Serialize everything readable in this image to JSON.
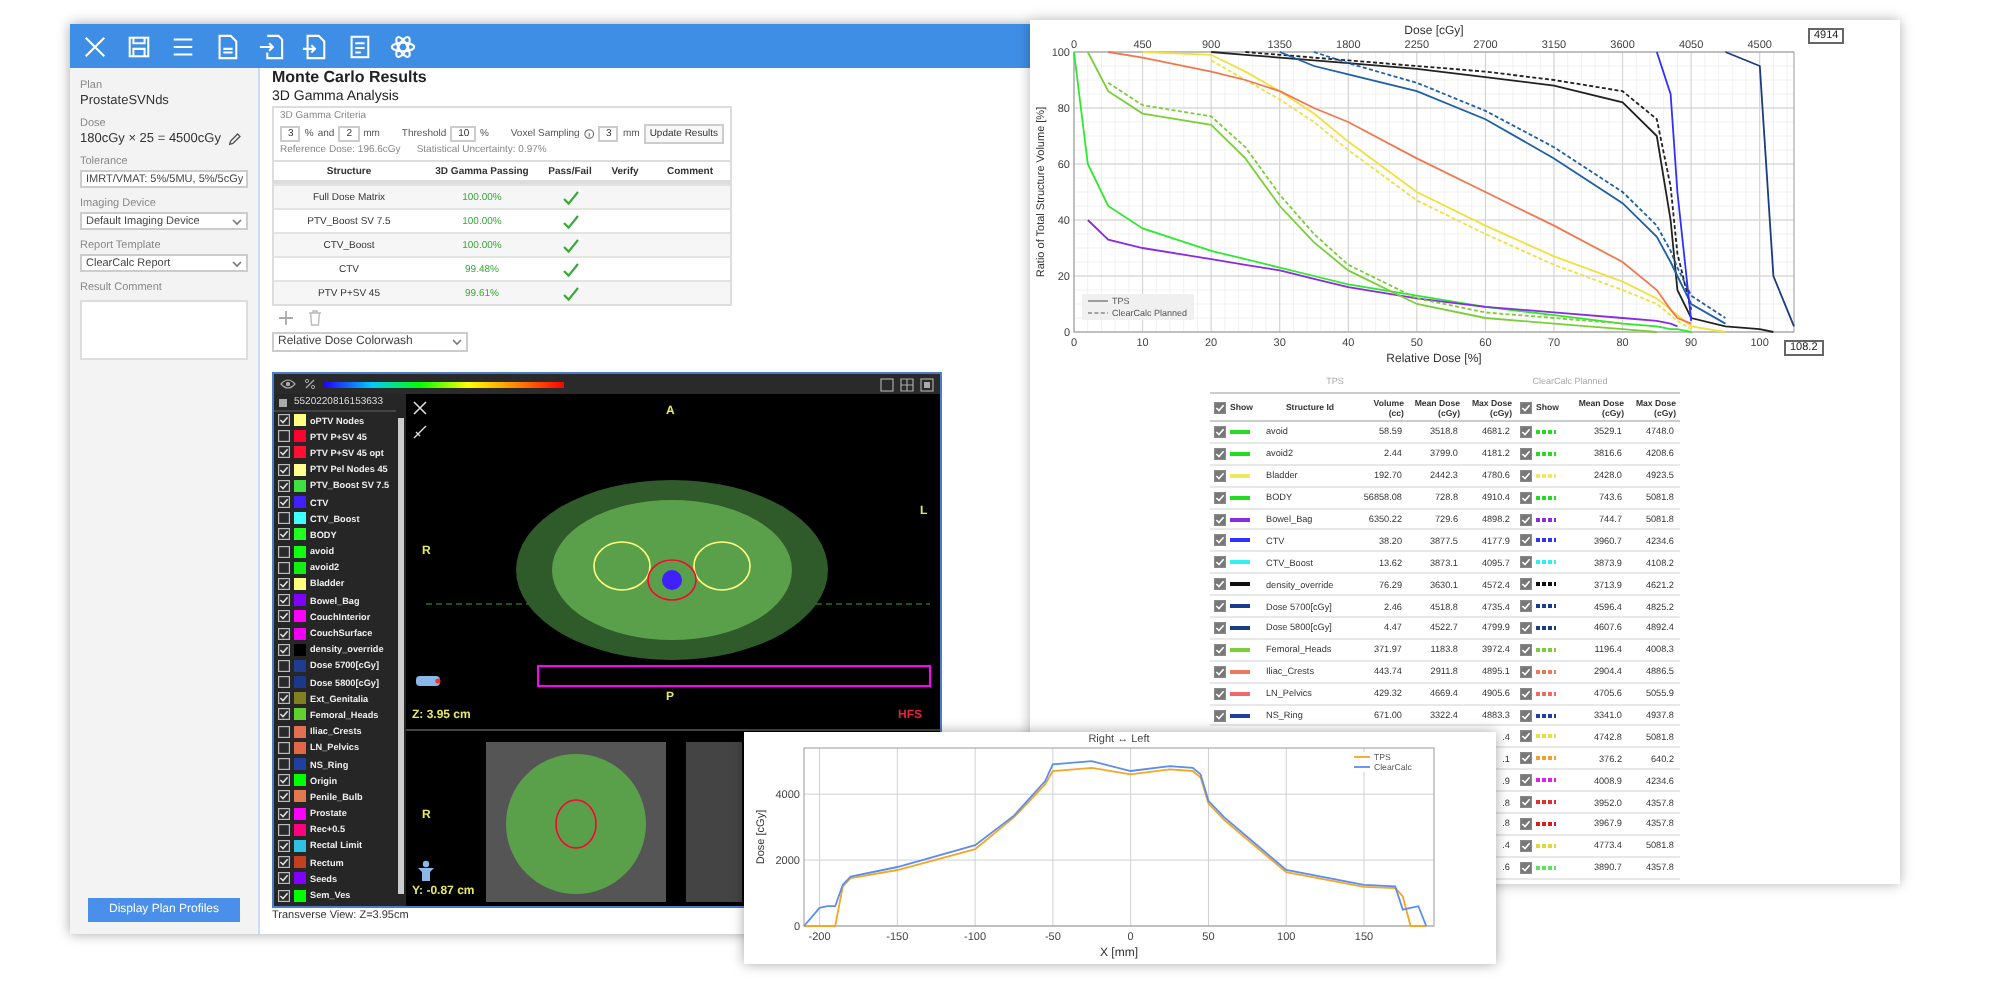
{
  "sidebar": {
    "fields": [
      {
        "label": "Plan",
        "value": "ProstateSVNds",
        "kind": "text"
      },
      {
        "label": "Dose",
        "value": "180cGy × 25 = 4500cGy",
        "kind": "editable"
      },
      {
        "label": "Tolerance",
        "value": "IMRT/VMAT: 5%/5MU, 5%/5cGy",
        "kind": "dropdown"
      },
      {
        "label": "Imaging Device",
        "value": "Default Imaging Device",
        "kind": "dropdown"
      },
      {
        "label": "Report Template",
        "value": "ClearCalc Report",
        "kind": "dropdown"
      },
      {
        "label": "Result Comment",
        "kind": "textarea"
      }
    ],
    "button": "Display Plan Profiles"
  },
  "results": {
    "title": "Monte Carlo Results",
    "subtitle": "3D Gamma Analysis",
    "criteria": {
      "title": "3D Gamma Criteria",
      "dose_percent": "3",
      "dose_unit": "%",
      "and": "and",
      "distance": "2",
      "distance_unit": "mm",
      "threshold_label": "Threshold",
      "threshold": "10",
      "threshold_unit": "%",
      "voxel_label": "Voxel Sampling",
      "voxel": "3",
      "voxel_unit": "mm",
      "button": "Update Results",
      "reference_dose": "Reference Dose: 196.6cGy",
      "uncertainty": "Statistical Uncertainty: 0.97%"
    },
    "table": {
      "columns": [
        "Structure",
        "3D Gamma Passing",
        "Pass/Fail",
        "Verify",
        "Comment"
      ],
      "rows": [
        {
          "structure": "Full Dose Matrix",
          "passing": "100.00%",
          "pass": true
        },
        {
          "structure": "PTV_Boost SV 7.5",
          "passing": "100.00%",
          "pass": true
        },
        {
          "structure": "CTV_Boost",
          "passing": "100.00%",
          "pass": true
        },
        {
          "structure": "CTV",
          "passing": "99.48%",
          "pass": true
        },
        {
          "structure": "PTV P+SV 45",
          "passing": "99.61%",
          "pass": true
        }
      ]
    },
    "display_mode": "Relative Dose Colorwash"
  },
  "viewer": {
    "plan_id": "5520220816153633",
    "structures": [
      {
        "name": "oPTV Nodes",
        "checked": true,
        "color": "#ffff80"
      },
      {
        "name": "PTV P+SV 45",
        "checked": false,
        "color": "#ff0030"
      },
      {
        "name": "PTV P+SV 45 opt",
        "checked": true,
        "color": "#ff1030"
      },
      {
        "name": "PTV Pel Nodes 45",
        "checked": true,
        "color": "#ffff90"
      },
      {
        "name": "PTV_Boost SV 7.5",
        "checked": true,
        "color": "#40e040"
      },
      {
        "name": "CTV",
        "checked": true,
        "color": "#4020ff"
      },
      {
        "name": "CTV_Boost",
        "checked": false,
        "color": "#40ffff"
      },
      {
        "name": "BODY",
        "checked": true,
        "color": "#20ff20"
      },
      {
        "name": "avoid",
        "checked": false,
        "color": "#10ff10"
      },
      {
        "name": "avoid2",
        "checked": false,
        "color": "#10f010"
      },
      {
        "name": "Bladder",
        "checked": true,
        "color": "#ffff80"
      },
      {
        "name": "Bowel_Bag",
        "checked": true,
        "color": "#8000ff"
      },
      {
        "name": "CouchInterior",
        "checked": true,
        "color": "#ff00ff"
      },
      {
        "name": "CouchSurface",
        "checked": true,
        "color": "#f000f0"
      },
      {
        "name": "density_override",
        "checked": true,
        "color": "#000000"
      },
      {
        "name": "Dose 5700[cGy]",
        "checked": false,
        "color": "#203c90"
      },
      {
        "name": "Dose 5800[cGy]",
        "checked": false,
        "color": "#1c3888"
      },
      {
        "name": "Ext_Genitalia",
        "checked": true,
        "color": "#808020"
      },
      {
        "name": "Femoral_Heads",
        "checked": true,
        "color": "#60d030"
      },
      {
        "name": "Iliac_Crests",
        "checked": false,
        "color": "#e07050"
      },
      {
        "name": "LN_Pelvics",
        "checked": false,
        "color": "#e06848"
      },
      {
        "name": "NS_Ring",
        "checked": false,
        "color": "#2040a0"
      },
      {
        "name": "Origin",
        "checked": true,
        "color": "#00ff00"
      },
      {
        "name": "Penile_Bulb",
        "checked": true,
        "color": "#e07850"
      },
      {
        "name": "Prostate",
        "checked": true,
        "color": "#ff00ff"
      },
      {
        "name": "Rec+0.5",
        "checked": false,
        "color": "#ff0080"
      },
      {
        "name": "Rectal Limit",
        "checked": true,
        "color": "#30c0e0"
      },
      {
        "name": "Rectum",
        "checked": true,
        "color": "#c04020"
      },
      {
        "name": "Seeds",
        "checked": true,
        "color": "#8000ff"
      },
      {
        "name": "Sem_Ves",
        "checked": true,
        "color": "#00ff00"
      }
    ],
    "orientation": {
      "anterior": "A",
      "right": "R",
      "left": "L",
      "posterior": "P",
      "lower_right": "R"
    },
    "patient_position": "HFS",
    "z_position": "Z: 3.95 cm",
    "y_position": "Y: -0.87 cm",
    "caption": "Transverse View: Z=3.95cm"
  },
  "dvh": {
    "dose_axis": {
      "title": "Dose [cGy]",
      "ticks": [
        "0",
        "450",
        "900",
        "1350",
        "1800",
        "2250",
        "2700",
        "3150",
        "3600",
        "4050",
        "4500"
      ]
    },
    "legend": [
      {
        "label": "TPS",
        "dashed": false
      },
      {
        "label": "ClearCalc Planned",
        "dashed": true
      }
    ],
    "chart_data": {
      "type": "line",
      "xlabel": "Relative Dose [%]",
      "ylabel": "Ratio of Total Structure Volume [%]",
      "grid": true,
      "x": [
        0,
        2,
        5,
        10,
        20,
        25,
        30,
        35,
        40,
        50,
        60,
        70,
        80,
        85,
        87,
        88,
        90,
        95,
        100,
        102,
        105
      ],
      "series": [
        {
          "color": "#2ee82e",
          "line_style": "solid",
          "values": [
            100,
            60,
            45,
            37,
            29,
            26,
            23,
            20,
            17,
            13,
            9,
            6,
            3,
            2,
            1,
            1,
            0,
            null,
            null,
            null,
            null
          ]
        },
        {
          "color": "#8a2be2",
          "line_style": "solid",
          "values": [
            null,
            40,
            33,
            30,
            26,
            24,
            22,
            19,
            16,
            12,
            9,
            7,
            5,
            4,
            3,
            2,
            null,
            null,
            null,
            null,
            null
          ]
        },
        {
          "color": "#f0e040",
          "line_style": "solid",
          "values": [
            null,
            null,
            null,
            100,
            99,
            93,
            86,
            78,
            68,
            50,
            38,
            27,
            18,
            12,
            8,
            6,
            2,
            0,
            null,
            null,
            null
          ]
        },
        {
          "color": "#f0e040",
          "line_style": "dashed",
          "values": [
            null,
            null,
            null,
            null,
            97,
            90,
            83,
            75,
            65,
            47,
            35,
            24,
            15,
            10,
            6,
            4,
            1,
            null,
            null,
            null,
            null
          ]
        },
        {
          "color": "#7ccd3a",
          "line_style": "solid",
          "values": [
            null,
            100,
            86,
            78,
            74,
            62,
            45,
            32,
            22,
            10,
            5,
            3,
            1,
            0,
            null,
            null,
            null,
            null,
            null,
            null,
            null
          ]
        },
        {
          "color": "#7ccd3a",
          "line_style": "dashed",
          "values": [
            null,
            null,
            89,
            81,
            77,
            66,
            49,
            35,
            24,
            12,
            7,
            5,
            3,
            null,
            null,
            null,
            null,
            null,
            null,
            null,
            null
          ]
        },
        {
          "color": "#222222",
          "line_style": "solid",
          "values": [
            null,
            null,
            null,
            null,
            100,
            99,
            98,
            97,
            96,
            94,
            91,
            88,
            82,
            70,
            40,
            15,
            5,
            2,
            1,
            0,
            null
          ]
        },
        {
          "color": "#222222",
          "line_style": "dashed",
          "values": [
            null,
            null,
            null,
            null,
            null,
            100,
            99,
            98,
            97,
            95,
            93,
            90,
            86,
            76,
            52,
            28,
            8,
            null,
            null,
            null,
            null
          ]
        },
        {
          "color": "#1f5fa8",
          "line_style": "solid",
          "values": [
            null,
            null,
            null,
            null,
            null,
            null,
            100,
            95,
            92,
            86,
            76,
            62,
            46,
            34,
            25,
            20,
            10,
            3,
            null,
            null,
            null
          ]
        },
        {
          "color": "#1f5fa8",
          "line_style": "dashed",
          "values": [
            null,
            null,
            null,
            null,
            null,
            null,
            null,
            100,
            96,
            89,
            79,
            66,
            50,
            38,
            29,
            23,
            13,
            5,
            null,
            null,
            null
          ]
        },
        {
          "color": "#f07850",
          "line_style": "solid",
          "values": [
            null,
            null,
            100,
            98,
            93,
            90,
            86,
            80,
            75,
            62,
            50,
            38,
            25,
            15,
            8,
            5,
            3,
            null,
            null,
            null,
            null
          ]
        },
        {
          "color": "#3030ff",
          "line_style": "solid",
          "values": [
            null,
            null,
            null,
            null,
            null,
            null,
            null,
            null,
            null,
            null,
            null,
            null,
            null,
            100,
            85,
            50,
            4,
            null,
            null,
            null,
            null
          ]
        },
        {
          "color": "#1a3c80",
          "line_style": "solid",
          "values": [
            null,
            null,
            null,
            null,
            null,
            null,
            null,
            null,
            null,
            null,
            null,
            null,
            null,
            null,
            null,
            null,
            null,
            100,
            95,
            20,
            2
          ]
        }
      ],
      "xlim": [
        0,
        105
      ],
      "ylim": [
        0,
        100
      ],
      "xticks": [
        0,
        10,
        20,
        30,
        40,
        50,
        60,
        70,
        80,
        90,
        100
      ],
      "yticks": [
        0,
        20,
        40,
        60,
        80,
        100
      ]
    },
    "top_readout": "4914",
    "bottom_readout": "108.2",
    "table": {
      "group_headers": [
        "TPS",
        "ClearCalc Planned"
      ],
      "show_all_checked": [
        true,
        true
      ],
      "columns": [
        "Show",
        "Structure Id",
        "Volume (cc)",
        "Mean Dose (cGy)",
        "Max Dose (cGy)",
        "Show",
        "Mean Dose (cGy)",
        "Max Dose (cGy)"
      ],
      "rows": [
        {
          "kind": "full",
          "color": "#22dd22",
          "tps_show": true,
          "name": "avoid",
          "volume": "58.59",
          "tps_mean": "3518.8",
          "tps_max": "4681.2",
          "cc_show": true,
          "cc_mean": "3529.1",
          "cc_max": "4748.0"
        },
        {
          "kind": "full",
          "color": "#22dd22",
          "tps_show": true,
          "name": "avoid2",
          "volume": "2.44",
          "tps_mean": "3799.0",
          "tps_max": "4181.2",
          "cc_show": true,
          "cc_mean": "3816.6",
          "cc_max": "4208.6"
        },
        {
          "kind": "full",
          "color": "#f0e860",
          "tps_show": true,
          "name": "Bladder",
          "volume": "192.70",
          "tps_mean": "2442.3",
          "tps_max": "4780.6",
          "cc_show": true,
          "cc_mean": "2428.0",
          "cc_max": "4923.5"
        },
        {
          "kind": "full",
          "color": "#22dd22",
          "tps_show": true,
          "name": "BODY",
          "volume": "56858.08",
          "tps_mean": "728.8",
          "tps_max": "4910.4",
          "cc_show": true,
          "cc_mean": "743.6",
          "cc_max": "5081.8"
        },
        {
          "kind": "full",
          "color": "#8a2be2",
          "tps_show": true,
          "name": "Bowel_Bag",
          "volume": "6350.22",
          "tps_mean": "729.6",
          "tps_max": "4898.2",
          "cc_show": true,
          "cc_mean": "744.7",
          "cc_max": "5081.8"
        },
        {
          "kind": "full",
          "color": "#3030ff",
          "tps_show": true,
          "name": "CTV",
          "volume": "38.20",
          "tps_mean": "3877.5",
          "tps_max": "4177.9",
          "cc_show": true,
          "cc_mean": "3960.7",
          "cc_max": "4234.6"
        },
        {
          "kind": "full",
          "color": "#30f0f0",
          "tps_show": true,
          "name": "CTV_Boost",
          "volume": "13.62",
          "tps_mean": "3873.1",
          "tps_max": "4095.7",
          "cc_show": true,
          "cc_mean": "3873.9",
          "cc_max": "4108.2"
        },
        {
          "kind": "full",
          "color": "#111111",
          "tps_show": true,
          "name": "density_override",
          "volume": "76.29",
          "tps_mean": "3630.1",
          "tps_max": "4572.4",
          "cc_show": true,
          "cc_mean": "3713.9",
          "cc_max": "4621.2"
        },
        {
          "kind": "full",
          "color": "#1a3c90",
          "tps_show": true,
          "name": "Dose 5700[cGy]",
          "volume": "2.46",
          "tps_mean": "4518.8",
          "tps_max": "4735.4",
          "cc_show": true,
          "cc_mean": "4596.4",
          "cc_max": "4825.2"
        },
        {
          "kind": "full",
          "color": "#1a3c80",
          "tps_show": true,
          "name": "Dose 5800[cGy]",
          "volume": "4.47",
          "tps_mean": "4522.7",
          "tps_max": "4799.9",
          "cc_show": true,
          "cc_mean": "4607.6",
          "cc_max": "4892.4"
        },
        {
          "kind": "full",
          "color": "#7ccd3a",
          "tps_show": true,
          "name": "Femoral_Heads",
          "volume": "371.97",
          "tps_mean": "1183.8",
          "tps_max": "3972.4",
          "cc_show": true,
          "cc_mean": "1196.4",
          "cc_max": "4008.3"
        },
        {
          "kind": "full",
          "color": "#f07860",
          "tps_show": true,
          "name": "Iliac_Crests",
          "volume": "443.74",
          "tps_mean": "2911.8",
          "tps_max": "4895.1",
          "cc_show": true,
          "cc_mean": "2904.4",
          "cc_max": "4886.5"
        },
        {
          "kind": "full",
          "color": "#f06868",
          "tps_show": true,
          "name": "LN_Pelvics",
          "volume": "429.32",
          "tps_mean": "4669.4",
          "tps_max": "4905.6",
          "cc_show": true,
          "cc_mean": "4705.6",
          "cc_max": "5055.9"
        },
        {
          "kind": "full",
          "color": "#2040a0",
          "tps_show": true,
          "name": "NS_Ring",
          "volume": "671.00",
          "tps_mean": "3322.4",
          "tps_max": "4883.3",
          "cc_show": true,
          "cc_mean": "3341.0",
          "cc_max": "4937.8"
        },
        {
          "kind": "partial",
          "color": "#e8e040",
          "tps_max": ".4",
          "cc_show": true,
          "cc_mean": "4742.8",
          "cc_max": "5081.8"
        },
        {
          "kind": "partial",
          "color": "#f0a030",
          "tps_max": ".1",
          "cc_show": true,
          "cc_mean": "376.2",
          "cc_max": "640.2"
        },
        {
          "kind": "partial",
          "color": "#e020e0",
          "tps_max": ".9",
          "cc_show": true,
          "cc_mean": "4008.9",
          "cc_max": "4234.6"
        },
        {
          "kind": "partial",
          "color": "#e03030",
          "tps_max": ".8",
          "cc_show": true,
          "cc_mean": "3952.0",
          "cc_max": "4357.8"
        },
        {
          "kind": "partial",
          "color": "#d02020",
          "tps_max": ".8",
          "cc_show": true,
          "cc_mean": "3967.9",
          "cc_max": "4357.8"
        },
        {
          "kind": "partial",
          "color": "#e0d838",
          "tps_max": ".4",
          "cc_show": true,
          "cc_mean": "4773.4",
          "cc_max": "5081.8"
        },
        {
          "kind": "partial",
          "color": "#60e060",
          "tps_max": ".6",
          "cc_show": true,
          "cc_mean": "3890.7",
          "cc_max": "4357.8"
        }
      ]
    }
  },
  "profile": {
    "chart_data": {
      "type": "line",
      "title": "Right ↔ Left",
      "xlabel": "X [mm]",
      "ylabel": "Dose [cGy]",
      "grid": true,
      "legend": "upper right",
      "x": [
        -210,
        -200,
        -195,
        -190,
        -185,
        -180,
        -150,
        -100,
        -75,
        -55,
        -50,
        -25,
        0,
        25,
        40,
        45,
        50,
        60,
        75,
        100,
        150,
        170,
        175,
        180,
        185,
        190
      ],
      "series": [
        {
          "name": "TPS",
          "color": "#f5a623",
          "values": [
            0,
            0,
            0,
            0,
            1200,
            1450,
            1700,
            2330,
            3300,
            4300,
            4700,
            4800,
            4600,
            4750,
            4700,
            4500,
            3720,
            3220,
            2620,
            1630,
            1190,
            1150,
            900,
            0,
            0,
            0
          ]
        },
        {
          "name": "ClearCalc",
          "color": "#5b8def",
          "values": [
            0,
            550,
            600,
            600,
            1250,
            1500,
            1790,
            2450,
            3350,
            4400,
            4900,
            5000,
            4700,
            4850,
            4800,
            4600,
            3800,
            3300,
            2700,
            1700,
            1250,
            1200,
            500,
            550,
            600,
            0
          ]
        }
      ],
      "xlim": [
        -210,
        195
      ],
      "ylim": [
        0,
        5400
      ],
      "xticks": [
        -200,
        -150,
        -100,
        -50,
        0,
        50,
        100,
        150
      ],
      "yticks": [
        0,
        2000,
        4000
      ]
    }
  }
}
